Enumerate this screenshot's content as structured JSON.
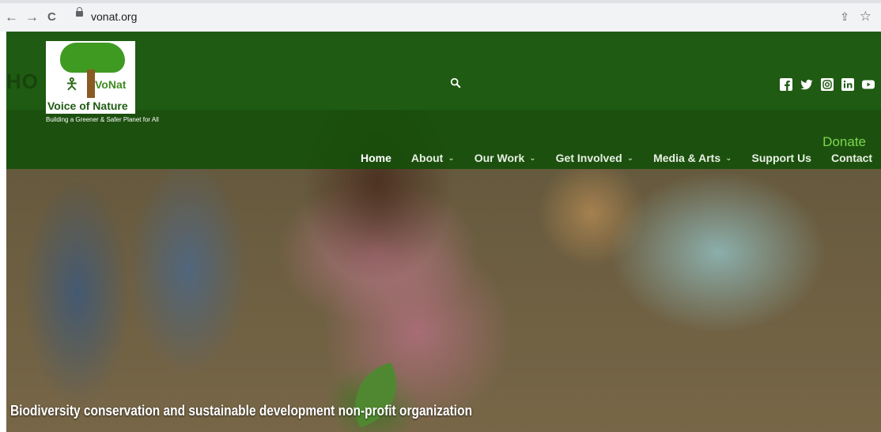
{
  "browser": {
    "back_glyph": "←",
    "forward_glyph": "→",
    "reload_glyph": "C",
    "url": "vonat.org",
    "share_glyph": "⇪",
    "star_glyph": "☆",
    "icons": [
      "back-arrow-icon",
      "forward-arrow-icon",
      "reload-icon",
      "lock-icon",
      "share-icon",
      "bookmark-star-icon"
    ]
  },
  "header": {
    "ghost_title": "HO",
    "logo": {
      "mark": "VoNat",
      "name": "Voice of Nature"
    },
    "tagline": "Building a Greener & Safer Planet for All",
    "social": [
      "facebook-icon",
      "twitter-icon",
      "instagram-icon",
      "linkedin-icon",
      "youtube-icon"
    ]
  },
  "nav": {
    "donate": "Donate",
    "items": [
      {
        "label": "Home",
        "active": true
      },
      {
        "label": "About",
        "dropdown": true
      },
      {
        "label": "Our Work",
        "dropdown": true
      },
      {
        "label": "Get Involved",
        "dropdown": true
      },
      {
        "label": "Media & Arts",
        "dropdown": true
      },
      {
        "label": "Support Us"
      },
      {
        "label": "Contact"
      }
    ],
    "chevron": "⌄"
  },
  "hero": {
    "caption": "Biodiversity conservation and sustainable development non-profit organization"
  },
  "colors": {
    "header_green": "#1f5b12",
    "donate_green": "#7ed84f",
    "logo_green": "#3f9a22"
  }
}
